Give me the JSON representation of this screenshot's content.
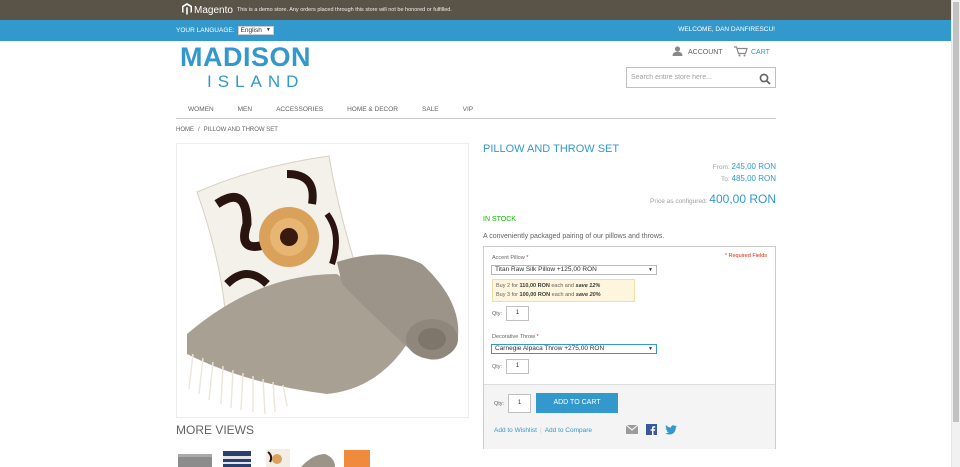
{
  "demo_notice": {
    "brand": "Magento",
    "text": "This is a demo store. Any orders placed through this store will not be honored or fulfilled."
  },
  "header": {
    "language_label": "Your Language:",
    "language_value": "English",
    "welcome": "Welcome, Dan Danfirescu!",
    "logo_line1": "MADISON",
    "logo_line2": "ISLAND",
    "account": "Account",
    "cart": "Cart",
    "search_placeholder": "Search entire store here..."
  },
  "nav": [
    "Women",
    "Men",
    "Accessories",
    "Home & Decor",
    "Sale",
    "VIP"
  ],
  "breadcrumb": [
    "Home",
    "Pillow and Throw Set"
  ],
  "product": {
    "name": "Pillow and Throw Set",
    "from_label": "From:",
    "from_value": "245,00 RON",
    "to_label": "To:",
    "to_value": "485,00 RON",
    "configured_label": "Price as configured:",
    "configured_value": "400,00 RON",
    "stock": "In stock",
    "description": "A conveniently packaged pairing of our pillows and throws."
  },
  "more_views": "More Views",
  "options": {
    "required_note": "* Required Fields",
    "pillow_label": "Accent Pillow",
    "pillow_selected": "Titan Raw Silk Pillow   +125,00 RON",
    "tier1_pre": "Buy 2 for ",
    "tier1_price": "110,00 RON",
    "tier1_mid": " each and ",
    "tier1_save": "save 12%",
    "tier2_pre": "Buy 3 for ",
    "tier2_price": "100,00 RON",
    "tier2_mid": " each and ",
    "tier2_save": "save 20%",
    "qty_label": "Qty:",
    "pillow_qty": "1",
    "throw_label": "Decorative Throw",
    "throw_selected": "Carnegie Alpaca Throw    +275,00 RON",
    "throw_qty": "1",
    "required_star": "*"
  },
  "cart_area": {
    "qty_label": "Qty:",
    "qty_value": "1",
    "add_to_cart": "Add to Cart",
    "wishlist": "Add to Wishlist",
    "separator": "|",
    "compare": "Add to Compare"
  },
  "icons": {
    "brand": "magento-logo-icon",
    "account": "account-icon",
    "cart": "cart-icon",
    "search": "search-icon",
    "email": "email-icon",
    "facebook": "facebook-icon",
    "twitter": "twitter-icon"
  },
  "colors": {
    "accent": "#3399cc",
    "demo_bar": "#5a5347",
    "in_stock": "#11b400",
    "required": "#df280a"
  }
}
